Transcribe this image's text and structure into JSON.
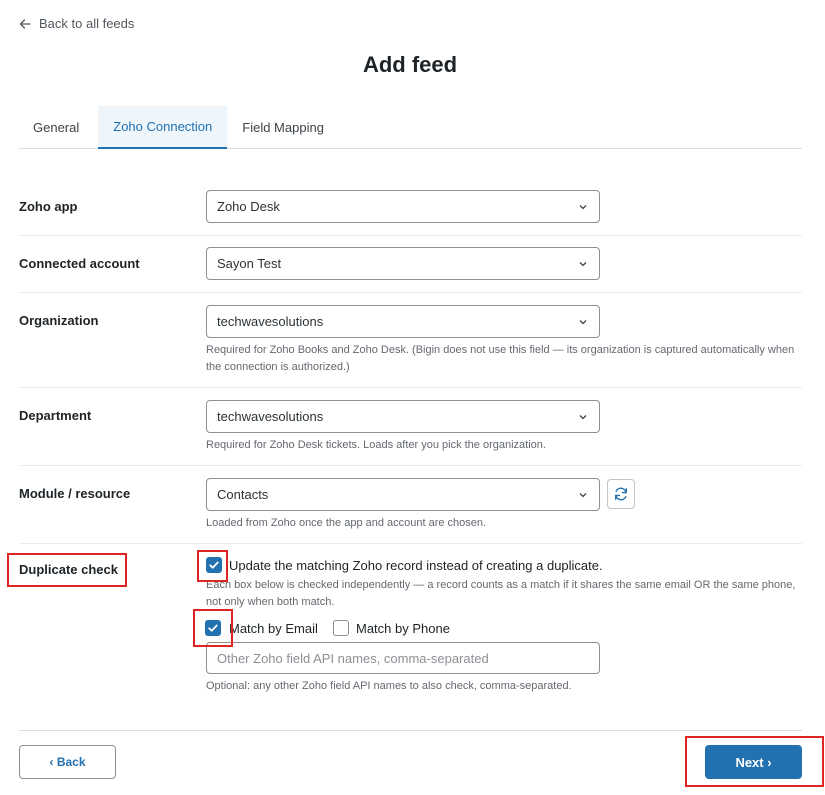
{
  "nav": {
    "back_label": "Back to all feeds"
  },
  "page": {
    "title": "Add feed"
  },
  "tabs": [
    {
      "label": "General",
      "active": false
    },
    {
      "label": "Zoho Connection",
      "active": true
    },
    {
      "label": "Field Mapping",
      "active": false
    }
  ],
  "form": {
    "zoho_app": {
      "label": "Zoho app",
      "value": "Zoho Desk"
    },
    "connected_account": {
      "label": "Connected account",
      "value": "Sayon Test"
    },
    "organization": {
      "label": "Organization",
      "value": "techwavesolutions",
      "help": "Required for Zoho Books and Zoho Desk. (Bigin does not use this field — its organization is captured automatically when the connection is authorized.)"
    },
    "department": {
      "label": "Department",
      "value": "techwavesolutions",
      "help": "Required for Zoho Desk tickets. Loads after you pick the organization."
    },
    "module": {
      "label": "Module / resource",
      "value": "Contacts",
      "help": "Loaded from Zoho once the app and account are chosen."
    },
    "duplicate_check": {
      "label": "Duplicate check",
      "update_label": "Update the matching Zoho record instead of creating a duplicate.",
      "update_checked": true,
      "help": "Each box below is checked independently — a record counts as a match if it shares the same email OR the same phone, not only when both match.",
      "match_email_label": "Match by Email",
      "match_email_checked": true,
      "match_phone_label": "Match by Phone",
      "match_phone_checked": false,
      "other_fields_placeholder": "Other Zoho field API names, comma-separated",
      "other_fields_value": "",
      "other_fields_help": "Optional: any other Zoho field API names to also check, comma-separated."
    }
  },
  "footer": {
    "back_label": "‹ Back",
    "next_label": "Next ›"
  },
  "colors": {
    "accent": "#2271b1",
    "highlight": "#e02424",
    "active_tab_bg": "#eef5fb"
  }
}
